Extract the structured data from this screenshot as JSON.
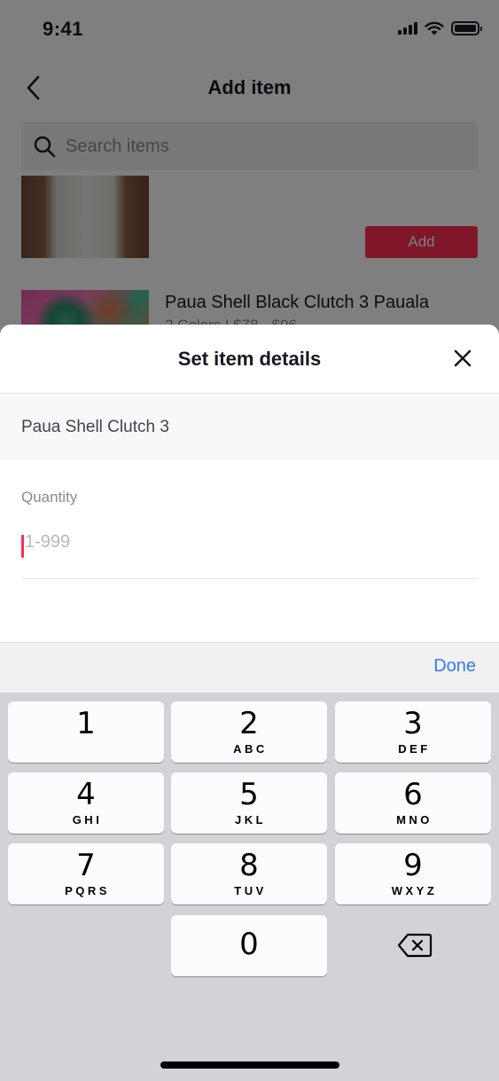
{
  "status_bar": {
    "time": "9:41"
  },
  "nav": {
    "title": "Add item"
  },
  "search": {
    "placeholder": "Search items"
  },
  "list": {
    "add_label": "Add",
    "item2_title": "Paua Shell Black Clutch 3 Paualа",
    "item2_meta": "2 Colors | $78 - $96"
  },
  "sheet": {
    "title": "Set item details",
    "item_name": "Paua Shell Clutch 3",
    "quantity_label": "Quantity",
    "quantity_placeholder": "1-999",
    "done_label": "Done"
  },
  "keyboard": {
    "keys": [
      {
        "digit": "1",
        "letters": ""
      },
      {
        "digit": "2",
        "letters": "ABC"
      },
      {
        "digit": "3",
        "letters": "DEF"
      },
      {
        "digit": "4",
        "letters": "GHI"
      },
      {
        "digit": "5",
        "letters": "JKL"
      },
      {
        "digit": "6",
        "letters": "MNO"
      },
      {
        "digit": "7",
        "letters": "PQRS"
      },
      {
        "digit": "8",
        "letters": "TUV"
      },
      {
        "digit": "9",
        "letters": "WXYZ"
      },
      {
        "digit": "0",
        "letters": ""
      }
    ]
  },
  "colors": {
    "accent": "#fe2c55",
    "done_blue": "#2f7bf5",
    "keyboard_bg": "#d1d3d9"
  }
}
